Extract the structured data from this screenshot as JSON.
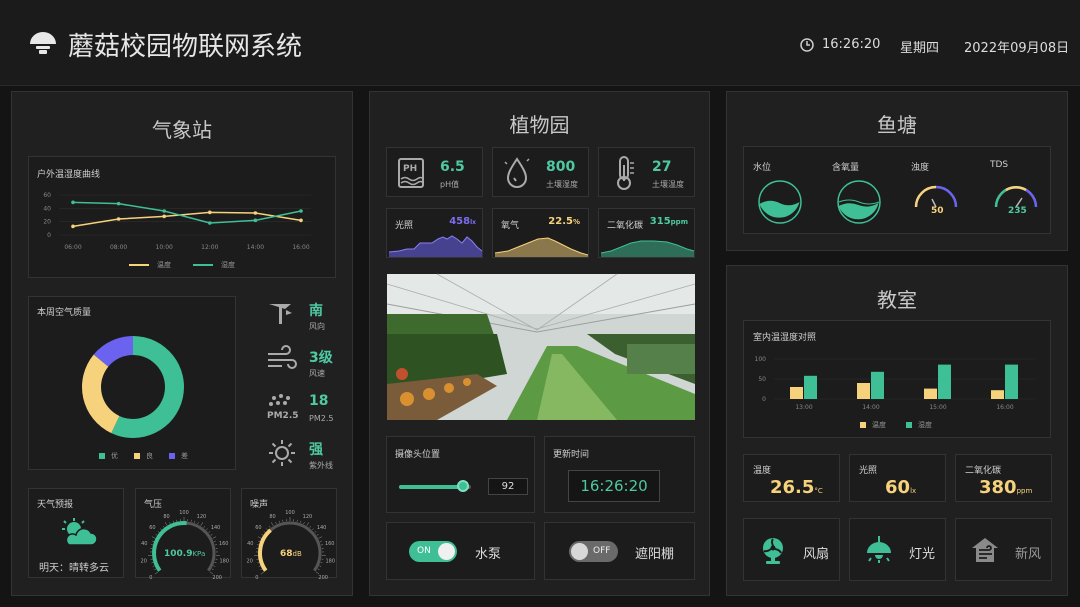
{
  "header": {
    "title": "蘑菇校园物联网系统",
    "time": "16:26:20",
    "weekday": "星期四",
    "date": "2022年09月08日"
  },
  "weather": {
    "title": "气象站",
    "curve": {
      "title": "户外温湿度曲线",
      "legend_temp": "温度",
      "legend_hum": "湿度"
    },
    "aq": {
      "title": "本周空气质量",
      "legend": [
        "优",
        "良",
        "差"
      ]
    },
    "wind_dir": {
      "value": "南",
      "label": "风向"
    },
    "wind_speed": {
      "value": "3级",
      "label": "风速"
    },
    "pm": {
      "value": "18",
      "label": "PM2.5"
    },
    "uv": {
      "value": "强",
      "label": "紫外线"
    },
    "forecast": {
      "title": "天气预报",
      "text": "明天：晴转多云"
    },
    "pressure": {
      "title": "气压",
      "value": "100.9",
      "unit": "KPa"
    },
    "noise": {
      "title": "噪声",
      "value": "68",
      "unit": "dB"
    }
  },
  "garden": {
    "title": "植物园",
    "ph": {
      "value": "6.5",
      "label": "pH值"
    },
    "soil_hum": {
      "value": "800",
      "label": "土壤湿度"
    },
    "soil_temp": {
      "value": "27",
      "label": "土壤温度"
    },
    "light": {
      "label": "光照",
      "value": "458",
      "unit": "lx"
    },
    "oxygen": {
      "label": "氧气",
      "value": "22.5",
      "unit": "%"
    },
    "co2": {
      "label": "二氧化碳",
      "value": "315",
      "unit": "ppm"
    },
    "camera": {
      "label": "摄像头位置",
      "value": "92"
    },
    "update": {
      "label": "更新时间",
      "value": "16:26:20"
    },
    "pump": {
      "state": "ON",
      "label": "水泵"
    },
    "shade": {
      "state": "OFF",
      "label": "遮阳棚"
    }
  },
  "pond": {
    "title": "鱼塘",
    "water_level": "水位",
    "oxygen": "含氧量",
    "turbidity": "浊度",
    "turbidity_value": "50",
    "tds": "TDS",
    "tds_value": "235"
  },
  "classroom": {
    "title": "教室",
    "chart_title": "室内温湿度对照",
    "legend_temp": "温度",
    "legend_hum": "湿度",
    "temp": {
      "label": "温度",
      "value": "26.5",
      "unit": "°C"
    },
    "light": {
      "label": "光照",
      "value": "60",
      "unit": "lx"
    },
    "co2": {
      "label": "二氧化碳",
      "value": "380",
      "unit": "ppm"
    },
    "fan": "风扇",
    "lamp": "灯光",
    "air": "新风"
  },
  "colors": {
    "teal": "#3fbf95",
    "yellow": "#f7d27c",
    "purple": "#6b62f0"
  },
  "chart_data": [
    {
      "type": "line",
      "title": "户外温湿度曲线",
      "x": [
        "06:00",
        "08:00",
        "10:00",
        "12:00",
        "14:00",
        "16:00"
      ],
      "ylim": [
        0,
        60
      ],
      "yticks": [
        0,
        20,
        40,
        60
      ],
      "series": [
        {
          "name": "温度",
          "values": [
            13,
            24,
            28,
            34,
            33,
            22
          ]
        },
        {
          "name": "湿度",
          "values": [
            49,
            47,
            36,
            18,
            22,
            36
          ]
        }
      ]
    },
    {
      "type": "pie",
      "title": "本周空气质量",
      "categories": [
        "优",
        "良",
        "差"
      ],
      "values": [
        57,
        29,
        14
      ]
    },
    {
      "type": "bar",
      "title": "室内温湿度对照",
      "categories": [
        "13:00",
        "14:00",
        "15:00",
        "16:00"
      ],
      "ylim": [
        0,
        150
      ],
      "yticks": [
        0,
        50,
        100
      ],
      "series": [
        {
          "name": "温度",
          "values": [
            30,
            40,
            26,
            22
          ]
        },
        {
          "name": "湿度",
          "values": [
            58,
            68,
            86,
            86
          ]
        }
      ]
    }
  ]
}
